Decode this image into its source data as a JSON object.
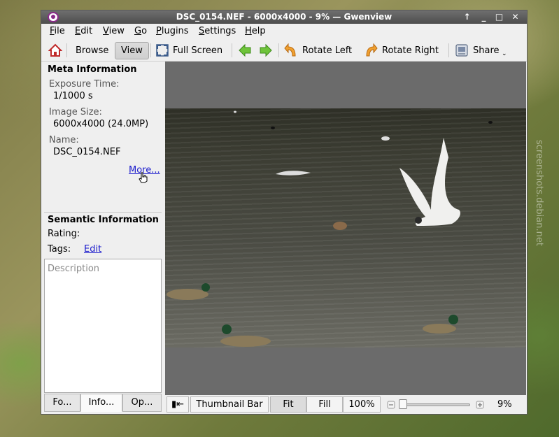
{
  "window": {
    "title": "DSC_0154.NEF - 6000x4000 - 9%  — Gwenview",
    "controls": {
      "up": "↑",
      "min": "_",
      "max": "□",
      "close": "✕"
    }
  },
  "menu": [
    {
      "mn": "F",
      "rest": "ile"
    },
    {
      "mn": "E",
      "rest": "dit"
    },
    {
      "mn": "V",
      "rest": "iew"
    },
    {
      "mn": "G",
      "rest": "o"
    },
    {
      "mn": "P",
      "rest": "lugins"
    },
    {
      "mn": "S",
      "rest": "ettings"
    },
    {
      "mn": "H",
      "rest": "elp"
    }
  ],
  "toolbar": {
    "browse": "Browse",
    "view": "View",
    "fullscreen": "Full Screen",
    "rotate_left": "Rotate Left",
    "rotate_right": "Rotate Right",
    "share": "Share"
  },
  "sidebar": {
    "meta_heading": "Meta Information",
    "exposure_label": "Exposure Time:",
    "exposure_value": "1/1000 s",
    "size_label": "Image Size:",
    "size_value": "6000x4000 (24.0MP)",
    "name_label": "Name:",
    "name_value": "DSC_0154.NEF",
    "more_link": "More...",
    "semantic_heading": "Semantic Information",
    "rating_label": "Rating:",
    "tags_label": "Tags:",
    "tags_edit": "Edit",
    "description_placeholder": "Description",
    "tabs": [
      "Fo...",
      "Info...",
      "Op..."
    ]
  },
  "statusbar": {
    "toggle": "▮⇤",
    "thumbnail_bar": "Thumbnail Bar",
    "fit": "Fit",
    "fill": "Fill",
    "actual": "100%",
    "zoom": "9%"
  },
  "desktop": {
    "watermark": "screenshots.debian.net"
  }
}
